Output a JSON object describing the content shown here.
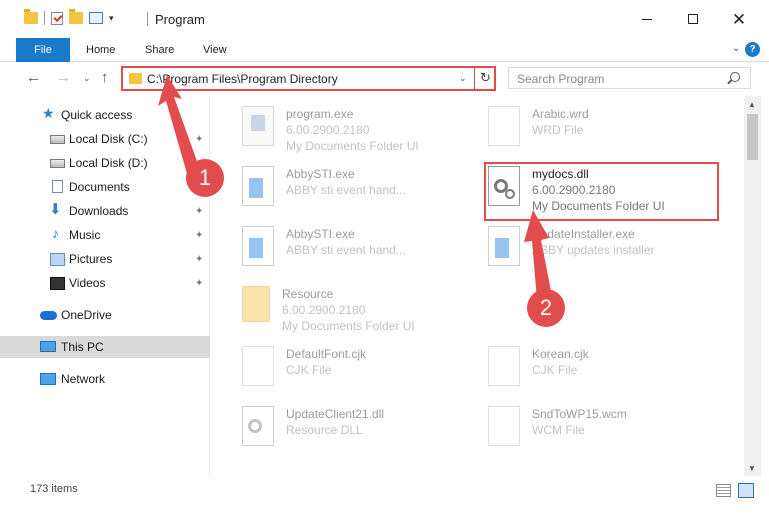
{
  "window": {
    "title": "Program",
    "minimize_icon": "minimize-icon",
    "maximize_icon": "maximize-icon",
    "close_icon": "close-icon"
  },
  "ribbon": {
    "tabs": [
      "File",
      "Home",
      "Share",
      "View"
    ],
    "active_tab": "File",
    "help_label": "?"
  },
  "address": {
    "path": "C:\\Program Files\\Program Directory",
    "search_placeholder": "Search Program"
  },
  "sidebar": {
    "items": [
      {
        "label": "Quick access",
        "icon": "star-icon",
        "pinned": false
      },
      {
        "label": "Local Disk (C:)",
        "icon": "disk-icon",
        "pinned": true
      },
      {
        "label": "Local Disk (D:)",
        "icon": "disk-icon",
        "pinned": false
      },
      {
        "label": "Documents",
        "icon": "document-icon",
        "pinned": true
      },
      {
        "label": "Downloads",
        "icon": "download-icon",
        "pinned": true
      },
      {
        "label": "Music",
        "icon": "music-icon",
        "pinned": true
      },
      {
        "label": "Pictures",
        "icon": "pictures-icon",
        "pinned": true
      },
      {
        "label": "Videos",
        "icon": "video-icon",
        "pinned": true
      },
      {
        "label": "OneDrive",
        "icon": "cloud-icon",
        "pinned": false
      },
      {
        "label": "This PC",
        "icon": "computer-icon",
        "pinned": false,
        "selected": true
      },
      {
        "label": "Network",
        "icon": "network-icon",
        "pinned": false
      }
    ]
  },
  "files": [
    {
      "name": "program.exe",
      "line2": "6.00.2900.2180",
      "line3": "My Documents Folder UI",
      "icon": "exe-icon"
    },
    {
      "name": "Arabic.wrd",
      "line2": "WRD File",
      "line3": "",
      "icon": "page-icon"
    },
    {
      "name": "AbbySTI.exe",
      "line2": "ABBY sti event hand...",
      "line3": "",
      "icon": "window-icon"
    },
    {
      "name": "mydocs.dll",
      "line2": "6.00.2900.2180",
      "line3": "My Documents Folder UI",
      "icon": "gear-dll-icon",
      "highlighted": true
    },
    {
      "name": "AbbySTI.exe",
      "line2": "ABBY sti event hand...",
      "line3": "",
      "icon": "window-icon"
    },
    {
      "name": "UpdateInstaller.exe",
      "line2": "ABBY updates installer",
      "line3": "",
      "icon": "window-icon"
    },
    {
      "name": "Resource",
      "line2": "6.00.2900.2180",
      "line3": "My Documents Folder UI",
      "icon": "folder-icon"
    },
    {
      "name": "DefaultFont.cjk",
      "line2": "CJK File",
      "line3": "",
      "icon": "page-icon"
    },
    {
      "name": "Korean.cjk",
      "line2": "CJK File",
      "line3": "",
      "icon": "page-icon"
    },
    {
      "name": "UpdateClient21.dll",
      "line2": "Resource DLL",
      "line3": "",
      "icon": "gear-dll-icon"
    },
    {
      "name": "SndToWP15.wcm",
      "line2": "WCM File",
      "line3": "",
      "icon": "page-icon"
    }
  ],
  "status": {
    "item_count": "173 items"
  },
  "annotations": {
    "step1": "1",
    "step2": "2",
    "color": "#e34c4c"
  }
}
